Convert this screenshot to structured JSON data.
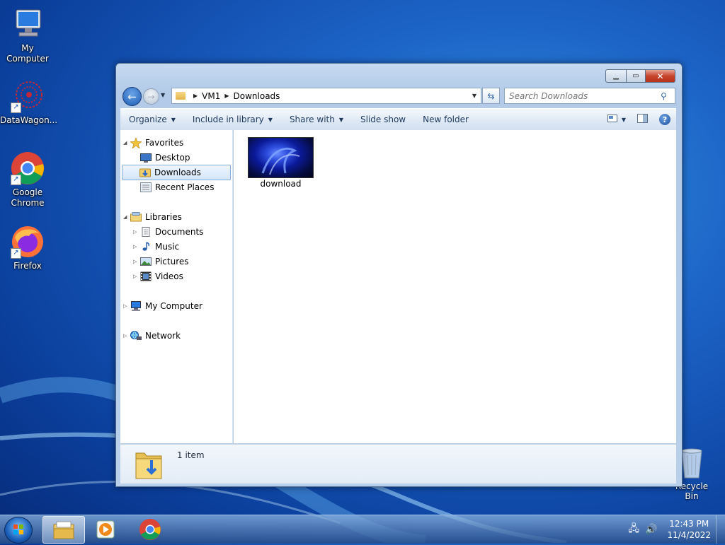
{
  "desktop": {
    "icons": [
      {
        "label": "My Computer"
      },
      {
        "label": "DataWagon..."
      },
      {
        "label": "Google Chrome"
      },
      {
        "label": "Firefox"
      },
      {
        "label": "Recycle Bin"
      }
    ]
  },
  "window": {
    "address": {
      "crumbs": [
        "VM1",
        "Downloads"
      ]
    },
    "search": {
      "placeholder": "Search Downloads"
    },
    "toolbar": {
      "organize": "Organize",
      "include_in_library": "Include in library",
      "share_with": "Share with",
      "slide_show": "Slide show",
      "new_folder": "New folder"
    },
    "nav": {
      "favorites": "Favorites",
      "desktop": "Desktop",
      "downloads": "Downloads",
      "recent_places": "Recent Places",
      "libraries": "Libraries",
      "documents": "Documents",
      "music": "Music",
      "pictures": "Pictures",
      "videos": "Videos",
      "my_computer": "My Computer",
      "network": "Network"
    },
    "content": {
      "items": [
        {
          "name": "download"
        }
      ]
    },
    "status": {
      "count": "1 item"
    }
  },
  "taskbar": {
    "clock": {
      "time": "12:43 PM",
      "date": "11/4/2022"
    }
  },
  "colors": {
    "accent": "#1c63c6",
    "selection": "#d4e6fb"
  }
}
